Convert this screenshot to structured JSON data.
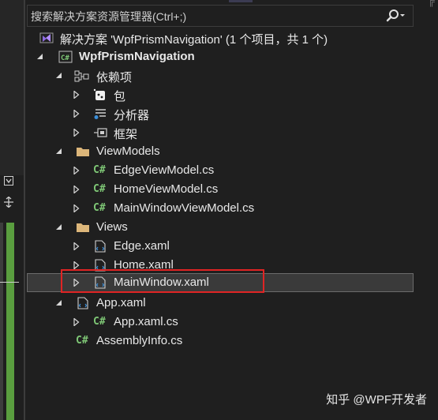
{
  "search": {
    "placeholder": "搜索解决方案资源管理器(Ctrl+;)"
  },
  "tree": {
    "solution": "解决方案 'WpfPrismNavigation' (1 个项目，共 1 个)",
    "project": "WpfPrismNavigation",
    "dependencies": "依赖项",
    "package": "包",
    "analyzers": "分析器",
    "frameworks": "框架",
    "viewmodels_folder": "ViewModels",
    "edge_vm": "EdgeViewModel.cs",
    "home_vm": "HomeViewModel.cs",
    "main_vm": "MainWindowViewModel.cs",
    "views_folder": "Views",
    "edge_xaml": "Edge.xaml",
    "home_xaml": "Home.xaml",
    "main_xaml": "MainWindow.xaml",
    "app_xaml": "App.xaml",
    "app_cs": "App.xaml.cs",
    "assembly_info": "AssemblyInfo.cs"
  },
  "watermark": "知乎 @WPF开发者",
  "colors": {
    "background": "#1f1f1f",
    "highlight": "#e02424",
    "csharp": "#7fc876",
    "folder": "#dcb67a"
  }
}
